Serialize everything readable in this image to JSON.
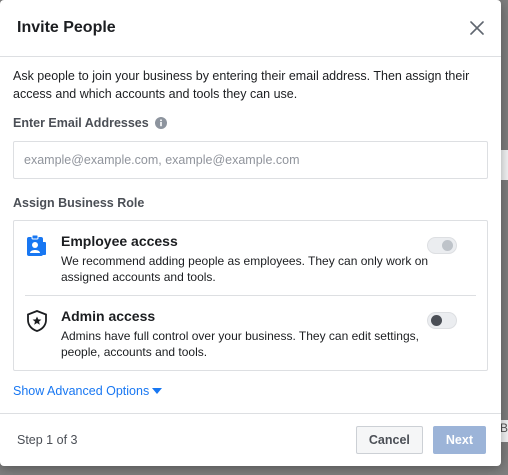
{
  "dialog": {
    "title": "Invite People",
    "intro": "Ask people to join your business by entering their email address. Then assign their access and which accounts and tools they can use.",
    "email_label": "Enter Email Addresses",
    "email_placeholder": "example@example.com, example@example.com",
    "email_value": "",
    "role_label": "Assign Business Role",
    "roles": [
      {
        "title": "Employee access",
        "description": "We recommend adding people as employees. They can only work on assigned accounts and tools.",
        "icon": "employee-badge-icon",
        "toggle_state": "on-disabled"
      },
      {
        "title": "Admin access",
        "description": "Admins have full control over your business. They can edit settings, people, accounts and tools.",
        "icon": "shield-star-icon",
        "toggle_state": "off"
      }
    ],
    "advanced_link": "Show Advanced Options",
    "step": "Step 1 of 3",
    "cancel_label": "Cancel",
    "next_label": "Next"
  },
  "background": {
    "partial_text": "B"
  },
  "colors": {
    "accent": "#1877f2",
    "next_disabled": "#9cb4d8",
    "border": "#dddfe2"
  }
}
